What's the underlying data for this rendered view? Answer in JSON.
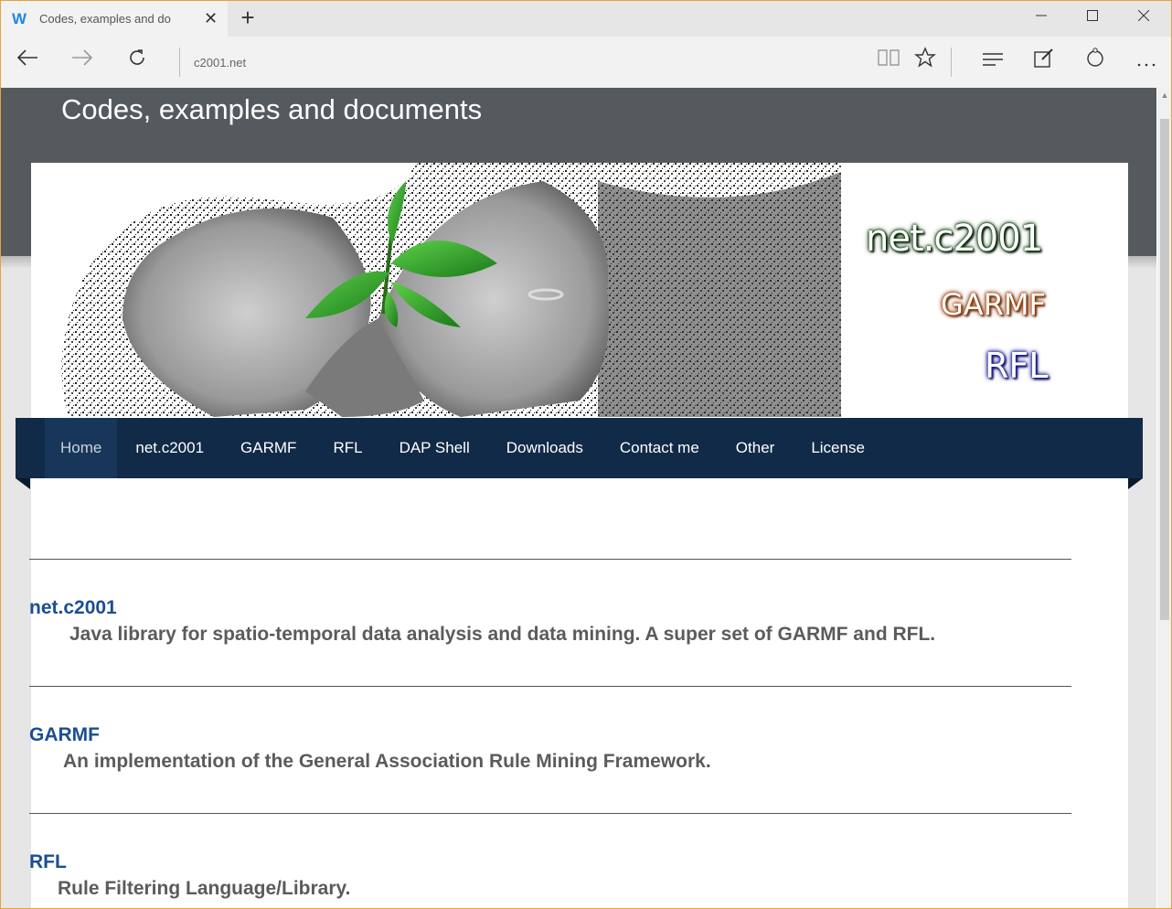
{
  "browser": {
    "tab_title": "Codes, examples and do",
    "favicon": "W",
    "close_glyph": "✕",
    "new_tab_glyph": "+",
    "address": "c2001.net",
    "icons": {
      "back": "back-arrow-icon",
      "forward": "forward-arrow-icon",
      "refresh": "refresh-icon",
      "reading_view": "book-icon",
      "favorite": "star-icon",
      "hub": "hub-lines-icon",
      "web_note": "pen-note-icon",
      "share": "share-icon",
      "more": "more-dots-icon"
    }
  },
  "site": {
    "title": "Codes, examples and documents",
    "logos": {
      "net": "net.c2001",
      "garmf": "GARMF",
      "rfl": "RFL"
    },
    "nav": [
      {
        "label": "Home",
        "active": true
      },
      {
        "label": "net.c2001",
        "active": false
      },
      {
        "label": "GARMF",
        "active": false
      },
      {
        "label": "RFL",
        "active": false
      },
      {
        "label": "DAP Shell",
        "active": false
      },
      {
        "label": "Downloads",
        "active": false
      },
      {
        "label": "Contact me",
        "active": false
      },
      {
        "label": "Other",
        "active": false
      },
      {
        "label": "License",
        "active": false
      }
    ],
    "entries": [
      {
        "name": "net.c2001",
        "description": "Java library for spatio-temporal data analysis and data mining. A super set of GARMF and RFL."
      },
      {
        "name": "GARMF",
        "description": "An implementation of the General Association Rule Mining Framework."
      },
      {
        "name": "RFL",
        "description": "Rule Filtering Language/Library."
      }
    ]
  },
  "colors": {
    "header": "#555a5e",
    "nav": "#112a47",
    "link": "#1a4e93",
    "description": "#5b5b5b"
  }
}
